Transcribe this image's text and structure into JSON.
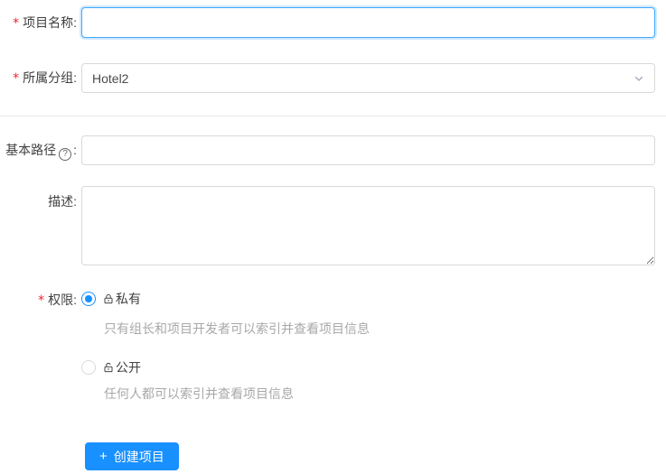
{
  "form": {
    "name_row": {
      "required_mark": "*",
      "label": "项目名称:",
      "value": ""
    },
    "group_row": {
      "required_mark": "*",
      "label": "所属分组:",
      "value": "Hotel2"
    },
    "path_row": {
      "label": "基本路径",
      "help_icon": "?",
      "colon": ":",
      "value": ""
    },
    "desc_row": {
      "label": "描述:",
      "value": ""
    },
    "perm_row": {
      "required_mark": "*",
      "label": "权限:",
      "options": [
        {
          "label": "私有",
          "desc": "只有组长和项目开发者可以索引并查看项目信息",
          "selected": true
        },
        {
          "label": "公开",
          "desc": "任何人都可以索引并查看项目信息",
          "selected": false
        }
      ]
    },
    "submit": {
      "plus": "+",
      "label": "创建项目"
    }
  },
  "colors": {
    "primary": "#1890ff",
    "focus_border": "#40a9ff",
    "input_border": "#d9d9d9",
    "divider": "#e8e8e8",
    "required": "#f5222d",
    "helper_text": "#a8a8a8",
    "label_text": "#404040"
  }
}
